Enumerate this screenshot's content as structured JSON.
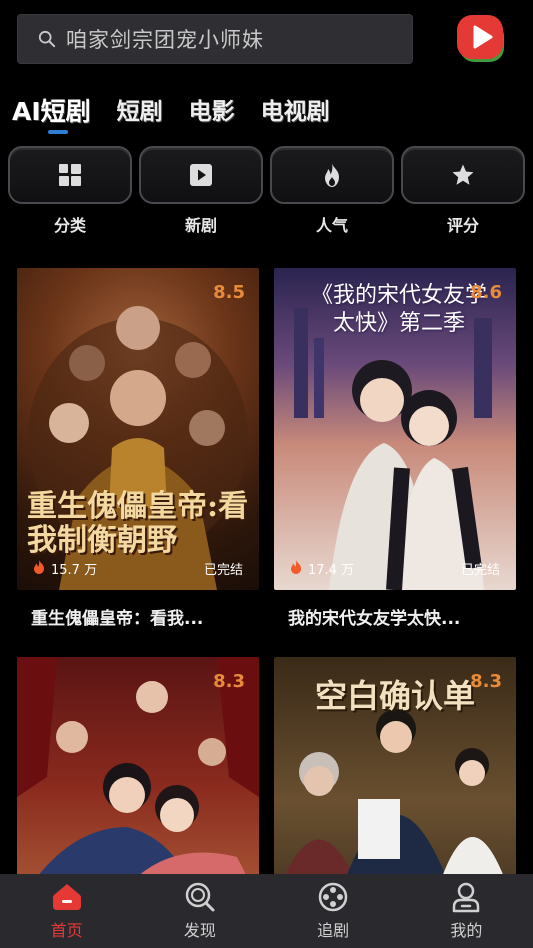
{
  "search": {
    "placeholder": "咱家剑宗团宠小师妹"
  },
  "brand": {
    "icon": "play-logo-icon",
    "color": "#e53935"
  },
  "tabs": [
    {
      "label": "AI短剧",
      "active": true
    },
    {
      "label": "短剧"
    },
    {
      "label": "电影"
    },
    {
      "label": "电视剧"
    }
  ],
  "categories": [
    {
      "label": "分类",
      "icon": "grid-icon"
    },
    {
      "label": "新剧",
      "icon": "play-square-icon"
    },
    {
      "label": "人气",
      "icon": "flame-icon"
    },
    {
      "label": "评分",
      "icon": "star-icon"
    }
  ],
  "cards": [
    {
      "rating": "8.5",
      "heat": "15.7 万",
      "status": "已完结",
      "title": "重生傀儡皇帝：看我...",
      "poster_text": "重生傀儡皇帝:看我制衡朝野"
    },
    {
      "rating": "8.6",
      "heat": "17.4 万",
      "status": "已完结",
      "title": "我的宋代女友学太快...",
      "poster_text": "《我的宋代女友学太快》第二季"
    },
    {
      "rating": "8.3"
    },
    {
      "rating": "8.3",
      "poster_text": "空白确认单"
    }
  ],
  "nav": [
    {
      "label": "首页",
      "icon": "home-icon",
      "active": true
    },
    {
      "label": "发现",
      "icon": "discover-icon"
    },
    {
      "label": "追剧",
      "icon": "film-reel-icon"
    },
    {
      "label": "我的",
      "icon": "profile-icon"
    }
  ],
  "colors": {
    "accent": "#e53935",
    "rating": "#e98a3a",
    "tab_indicator": "#2d7fd6"
  }
}
